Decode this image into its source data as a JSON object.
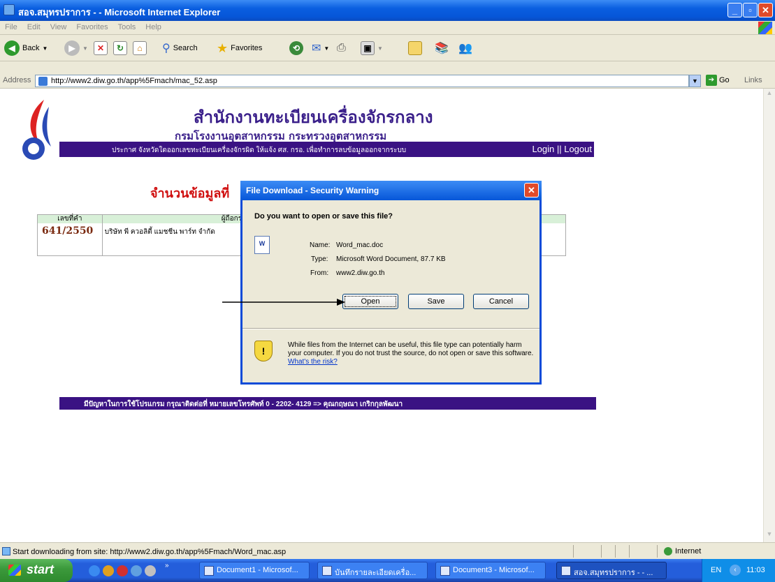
{
  "window": {
    "title": "สอจ.สมุทรปราการ - - Microsoft Internet Explorer",
    "minimize": "_",
    "maximize": "▫",
    "close": "✕"
  },
  "menu": [
    "File",
    "Edit",
    "View",
    "Favorites",
    "Tools",
    "Help"
  ],
  "toolbar": {
    "back": "Back",
    "search": "Search",
    "favorites": "Favorites"
  },
  "address": {
    "label": "Address",
    "url": "http://www2.diw.go.th/app%5Fmach/mac_52.asp",
    "go": "Go",
    "links": "Links"
  },
  "page": {
    "title": "สำนักงานทะเบียนเครื่องจักรกลาง",
    "subtitle": "กรมโรงงานอุตสาหกรรม กระทรวงอุตสาหกรรม",
    "announcement": "ประกาศ จังหวัดใดออกเลขทะเบียนเครื่องจักรผิด ให้แจ้ง ศส. กรอ. เพื่อทำการลบข้อมูลออกจากระบบ",
    "login": "Login || Logout",
    "section_title": "จำนวนข้อมูลที่",
    "table": {
      "headers": [
        "เลขที่คำ",
        "ผู้ถือกรรมสิทธิ์"
      ],
      "rows": [
        {
          "no": "641/2550",
          "owner": "บริษัท พี ควอลิตี้ แมชชีน พาร์ท จำกัด"
        }
      ]
    },
    "footer": "มีปัญหาในการใช้โปรแกรม กรุณาติดต่อที่ หมายเลขโทรศัพท์ 0 - 2202- 4129 => คุณกฤษณา เกริกกุลพัฒนา"
  },
  "dialog": {
    "title": "File Download - Security Warning",
    "question": "Do you want to open or save this file?",
    "name_label": "Name:",
    "name": "Word_mac.doc",
    "type_label": "Type:",
    "type": "Microsoft Word Document, 87.7 KB",
    "from_label": "From:",
    "from": "www2.diw.go.th",
    "open": "Open",
    "save": "Save",
    "cancel": "Cancel",
    "warning": "While files from the Internet can be useful, this file type can potentially harm your computer. If you do not trust the source, do not open or save this software.",
    "risk_link": "What's the risk?"
  },
  "status": {
    "text": "Start downloading from site: http://www2.diw.go.th/app%5Fmach/Word_mac.asp",
    "zone": "Internet"
  },
  "taskbar": {
    "start": "start",
    "tasks": [
      "Document1 - Microsof...",
      "บันทึกรายละเอียดเครื่อ...",
      "Document3 - Microsof...",
      "สอจ.สมุทรปราการ - - ..."
    ],
    "lang": "EN",
    "clock": "11:03"
  }
}
